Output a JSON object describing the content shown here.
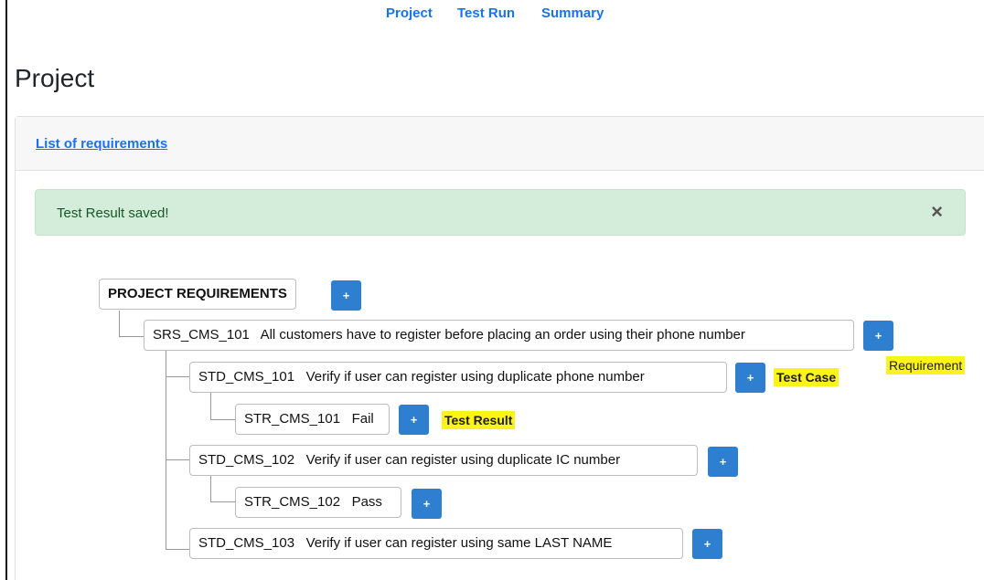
{
  "nav": {
    "project": "Project",
    "test_run": "Test Run",
    "summary": "Summary"
  },
  "page": {
    "title": "Project"
  },
  "card": {
    "header": "List of requirements"
  },
  "alert": {
    "message": "Test Result saved!",
    "close": "×"
  },
  "tree": {
    "root": "PROJECT REQUIREMENTS",
    "plus": "+",
    "requirement": {
      "id": "SRS_CMS_101",
      "text": "All customers have to register before placing an order using their phone number"
    },
    "test_cases": [
      {
        "id": "STD_CMS_101",
        "text": "Verify if user can register using duplicate phone number"
      },
      {
        "id": "STD_CMS_102",
        "text": "Verify if user can register using duplicate IC number"
      },
      {
        "id": "STD_CMS_103",
        "text": "Verify if user can register using same LAST NAME"
      }
    ],
    "test_results": [
      {
        "id": "STR_CMS_101",
        "status": "Fail"
      },
      {
        "id": "STR_CMS_102",
        "status": "Pass"
      }
    ]
  },
  "annotations": {
    "requirement": "Requirement",
    "test_case": "Test Case",
    "test_result": "Test Result"
  },
  "colors": {
    "link": "#1a73e8",
    "button": "#2f7fd1",
    "alert_bg": "#d4edda",
    "highlight": "#fbf319"
  }
}
